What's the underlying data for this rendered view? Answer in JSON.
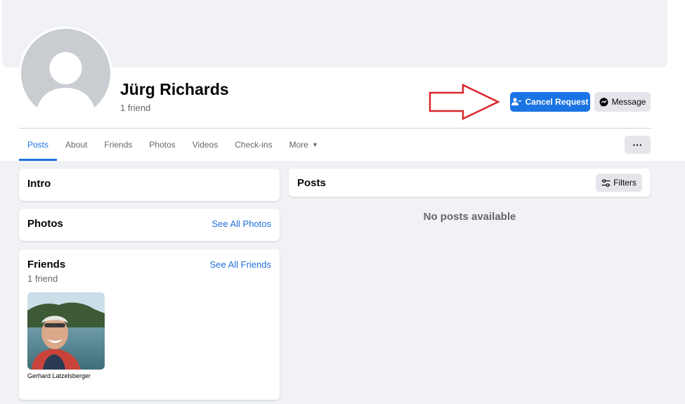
{
  "profile": {
    "name": "Jürg Richards",
    "friend_count": "1 friend",
    "avatar_icon": "default-avatar-icon"
  },
  "actions": {
    "cancel_request_label": "Cancel Request",
    "message_label": "Message",
    "more_label": "···"
  },
  "tabs": [
    {
      "label": "Posts",
      "active": true
    },
    {
      "label": "About"
    },
    {
      "label": "Friends"
    },
    {
      "label": "Photos"
    },
    {
      "label": "Videos"
    },
    {
      "label": "Check-ins"
    },
    {
      "label": "More"
    }
  ],
  "intro": {
    "title": "Intro"
  },
  "photos": {
    "title": "Photos",
    "link": "See All Photos"
  },
  "friends": {
    "title": "Friends",
    "link": "See All Friends",
    "count": "1 friend",
    "items": [
      {
        "name": "Gerhard Latzelsberger"
      }
    ]
  },
  "posts": {
    "title": "Posts",
    "filters_label": "Filters",
    "empty_message": "No posts available"
  },
  "colors": {
    "accent": "#1b74e4",
    "annotation_arrow": "#d9262c"
  }
}
